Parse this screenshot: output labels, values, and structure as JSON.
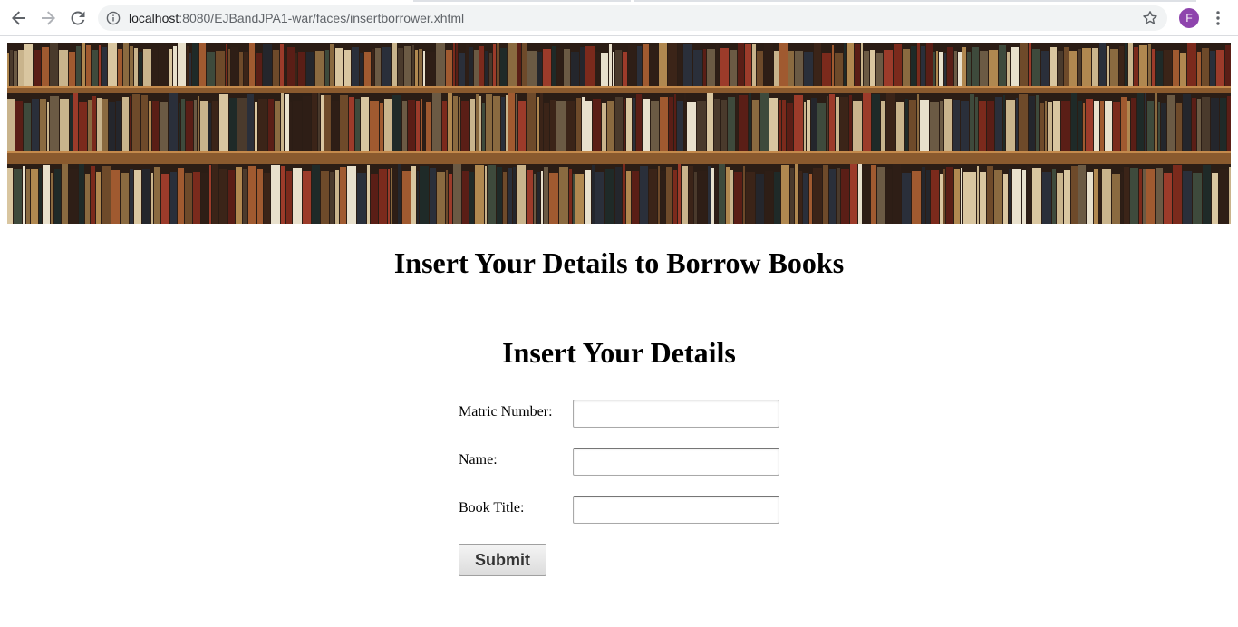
{
  "browser": {
    "url_host": "localhost",
    "url_path": ":8080/EJBandJPA1-war/faces/insertborrower.xhtml",
    "profile_initial": "F",
    "icons": {
      "back": "arrow-left-icon",
      "forward": "arrow-right-icon",
      "reload": "reload-icon",
      "info": "info-icon",
      "bookmark": "star-icon",
      "menu": "more-vert-icon"
    },
    "colors": {
      "avatar": "#8e44ad",
      "omnibox": "#f1f3f4"
    }
  },
  "page": {
    "title": "Insert Your Details to Borrow Books",
    "form_title": "Insert Your Details",
    "fields": [
      {
        "label": "Matric Number:",
        "value": ""
      },
      {
        "label": "Name:",
        "value": ""
      },
      {
        "label": "Book Title:",
        "value": ""
      }
    ],
    "submit_label": "Submit"
  }
}
